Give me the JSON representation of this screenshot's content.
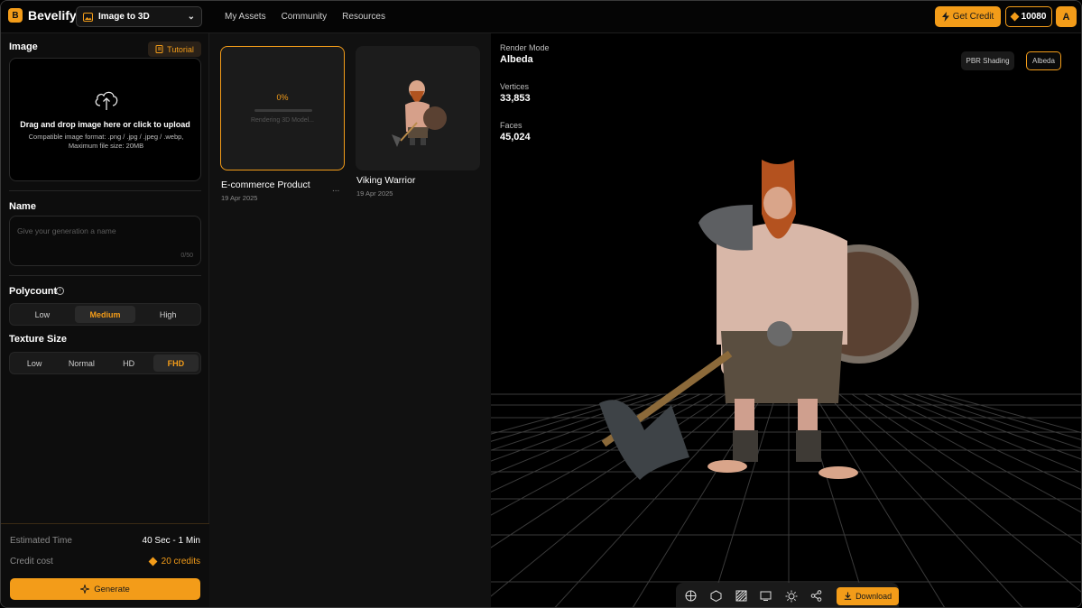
{
  "brand": {
    "name": "Bevelify",
    "logo_letter": "B"
  },
  "header": {
    "mode_select": {
      "value": "Image to 3D"
    },
    "nav": [
      "My Assets",
      "Community",
      "Resources"
    ],
    "get_credit_label": "Get Credit",
    "credit_balance": "10080",
    "avatar_letter": "A",
    "accent_color": "#f39c19"
  },
  "sidebar": {
    "image": {
      "label": "Image",
      "tutorial_label": "Tutorial",
      "upload_title": "Drag and drop image here or click to upload",
      "upload_hint": "Compatible image format: .png / .jpg / .jpeg / .webp, Maximum file size: 20MB"
    },
    "name": {
      "label": "Name",
      "placeholder": "Give your generation a name",
      "counter": "0/50"
    },
    "polycount": {
      "label": "Polycount",
      "options": [
        "Low",
        "Medium",
        "High"
      ],
      "selected": "Medium"
    },
    "texture": {
      "label": "Texture Size",
      "options": [
        "Low",
        "Normal",
        "HD",
        "FHD"
      ],
      "selected": "FHD"
    },
    "footer": {
      "estimated_time_label": "Estimated Time",
      "estimated_time_value": "40 Sec - 1 Min",
      "credit_cost_label": "Credit cost",
      "credit_cost_value": "20 credits",
      "generate_label": "Generate"
    }
  },
  "assets": [
    {
      "title": "E-commerce Product",
      "date": "19 Apr 2025",
      "progress_label": "0%",
      "progress": 0,
      "status": "Rendering 3D Model...",
      "more": "..."
    },
    {
      "title": "Viking Warrior",
      "date": "19 Apr 2025"
    }
  ],
  "viewer": {
    "render_mode_label": "Render Mode",
    "render_mode_value": "Albeda",
    "vertices_label": "Vertices",
    "vertices_value": "33,853",
    "faces_label": "Faces",
    "faces_value": "45,024",
    "mode_buttons": [
      "PBR Shading",
      "Albeda"
    ],
    "active_mode": "Albeda",
    "tools": [
      "wireframe-icon",
      "solid-icon",
      "texture-icon",
      "screen-icon",
      "light-icon",
      "share-icon"
    ],
    "download_label": "Download"
  }
}
